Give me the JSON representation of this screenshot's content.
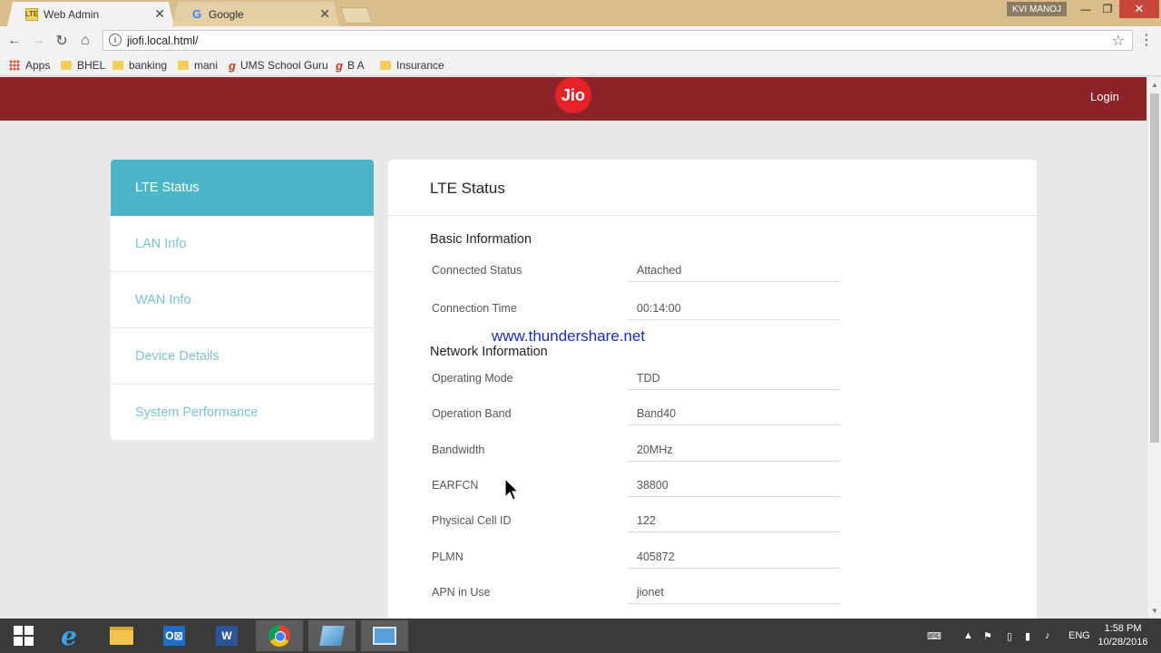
{
  "browser": {
    "tabs": [
      {
        "label": "Web Admin",
        "active": true
      },
      {
        "label": "Google",
        "active": false
      }
    ],
    "user_chip": "KVI MANOJ",
    "url": "jiofi.local.html/",
    "bookmarks": [
      {
        "label": "Apps",
        "icon": "apps-grid-icon"
      },
      {
        "label": "BHEL",
        "icon": "folder-icon"
      },
      {
        "label": "banking",
        "icon": "folder-icon"
      },
      {
        "label": "mani",
        "icon": "folder-icon"
      },
      {
        "label": "UMS School Guru",
        "icon": "ums-logo-icon"
      },
      {
        "label": "B A",
        "icon": "ums-logo-icon"
      },
      {
        "label": "Insurance",
        "icon": "folder-icon"
      }
    ]
  },
  "header": {
    "logo": "Jio",
    "login_label": "Login",
    "color": "#8b2328"
  },
  "sidebar": {
    "accent": "#4db6c6",
    "items": [
      {
        "label": "LTE Status",
        "active": true
      },
      {
        "label": "LAN Info",
        "active": false
      },
      {
        "label": "WAN Info",
        "active": false
      },
      {
        "label": "Device Details",
        "active": false
      },
      {
        "label": "System Performance",
        "active": false
      }
    ]
  },
  "panel": {
    "title": "LTE Status",
    "basic": {
      "heading": "Basic Information",
      "rows": [
        {
          "label": "Connected Status",
          "value": "Attached"
        },
        {
          "label": "Connection Time",
          "value": "00:14:00"
        }
      ]
    },
    "network": {
      "heading": "Network Information",
      "rows": [
        {
          "label": "Operating Mode",
          "value": "TDD"
        },
        {
          "label": "Operation Band",
          "value": "Band40"
        },
        {
          "label": "Bandwidth",
          "value": "20MHz"
        },
        {
          "label": "EARFCN",
          "value": "38800"
        },
        {
          "label": "Physical Cell ID",
          "value": "122"
        },
        {
          "label": "PLMN",
          "value": "405872"
        },
        {
          "label": "APN in Use",
          "value": "jionet"
        }
      ]
    }
  },
  "watermark": "www.thundershare.net",
  "taskbar": {
    "language": "ENG",
    "time": "1:58 PM",
    "date": "10/28/2016"
  }
}
